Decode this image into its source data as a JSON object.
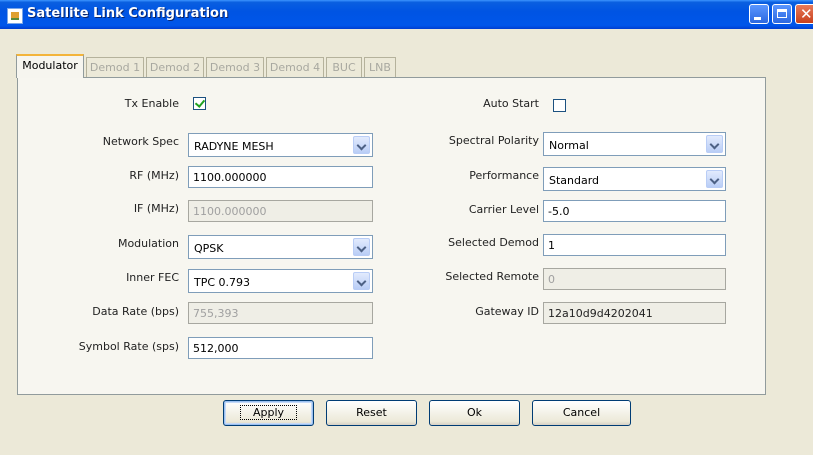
{
  "window": {
    "title": "Satellite Link Configuration"
  },
  "tabs": [
    {
      "label": "Modulator",
      "active": true
    },
    {
      "label": "Demod 1"
    },
    {
      "label": "Demod 2"
    },
    {
      "label": "Demod 3"
    },
    {
      "label": "Demod 4"
    },
    {
      "label": "BUC"
    },
    {
      "label": "LNB"
    }
  ],
  "left": {
    "tx_enable": {
      "label": "Tx Enable",
      "checked": true
    },
    "network_spec": {
      "label": "Network Spec",
      "value": "RADYNE MESH"
    },
    "rf": {
      "label": "RF (MHz)",
      "value": "1100.000000"
    },
    "if": {
      "label": "IF (MHz)",
      "value": "1100.000000"
    },
    "modulation": {
      "label": "Modulation",
      "value": "QPSK"
    },
    "inner_fec": {
      "label": "Inner FEC",
      "value": "TPC 0.793"
    },
    "data_rate": {
      "label": "Data Rate (bps)",
      "value": "755,393"
    },
    "symbol_rate": {
      "label": "Symbol Rate (sps)",
      "value": "512,000"
    }
  },
  "right": {
    "auto_start": {
      "label": "Auto Start",
      "checked": false
    },
    "spectral_polarity": {
      "label": "Spectral Polarity",
      "value": "Normal"
    },
    "performance": {
      "label": "Performance",
      "value": "Standard"
    },
    "carrier_level": {
      "label": "Carrier Level",
      "value": "-5.0"
    },
    "selected_demod": {
      "label": "Selected Demod",
      "value": "1"
    },
    "selected_remote": {
      "label": "Selected Remote",
      "value": "0"
    },
    "gateway_id": {
      "label": "Gateway ID",
      "value": "12a10d9d4202041"
    }
  },
  "buttons": {
    "apply": "Apply",
    "reset": "Reset",
    "ok": "Ok",
    "cancel": "Cancel"
  },
  "colors": {
    "titlebar": "#0054e3",
    "panel": "#f7f6f0",
    "window": "#ece9d8",
    "tab_accent": "#f3b43a"
  }
}
